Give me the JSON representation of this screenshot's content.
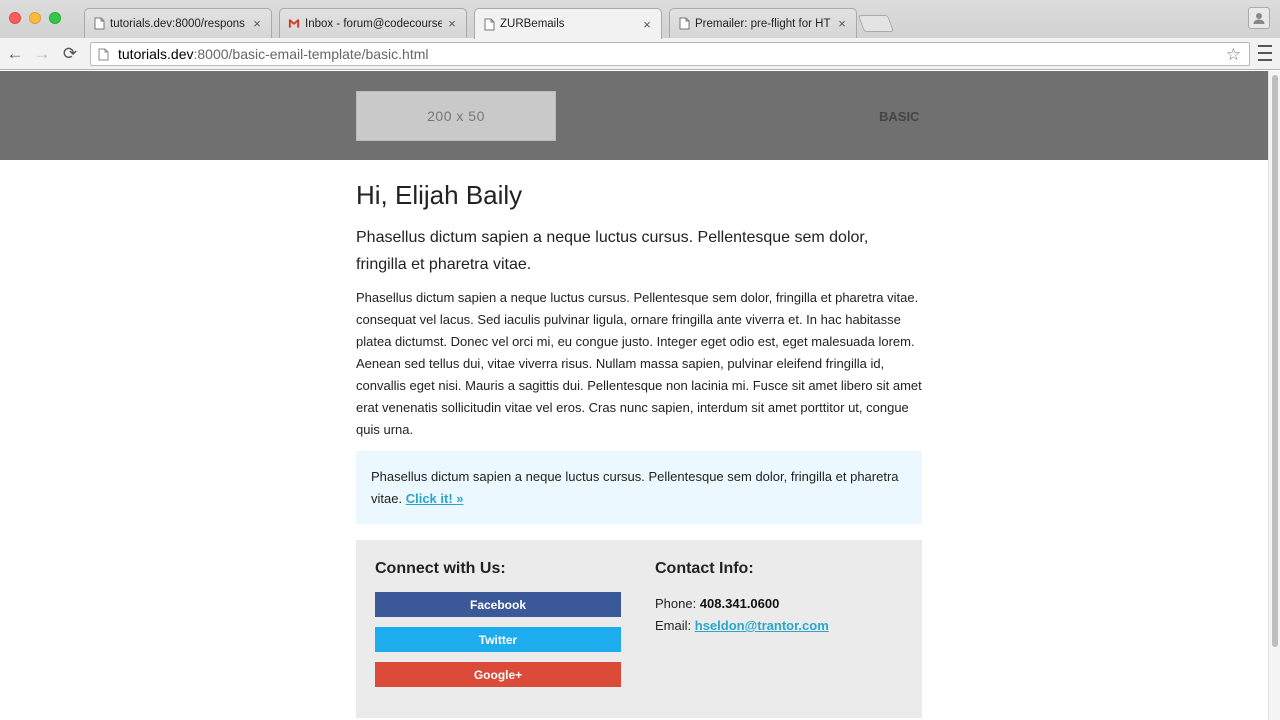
{
  "browser": {
    "tabs": [
      {
        "title": "tutorials.dev:8000/respons",
        "favicon": "page-icon",
        "active": false
      },
      {
        "title": "Inbox - forum@codecourse",
        "favicon": "gmail-icon",
        "active": false
      },
      {
        "title": "ZURBemails",
        "favicon": "page-icon",
        "active": true
      },
      {
        "title": "Premailer: pre-flight for HT",
        "favicon": "page-icon",
        "active": false
      }
    ],
    "tab_close_glyph": "×",
    "url_host": "tutorials.dev",
    "url_rest": ":8000/basic-email-template/basic.html",
    "back_glyph": "←",
    "forward_glyph": "→",
    "reload_glyph": "⟳",
    "star_glyph": "☆"
  },
  "email": {
    "header": {
      "logo_text": "200 x 50",
      "label": "BASIC"
    },
    "greeting": "Hi, Elijah Baily",
    "lead": "Phasellus dictum sapien a neque luctus cursus. Pellentesque sem dolor, fringilla et pharetra vitae.",
    "body": "Phasellus dictum sapien a neque luctus cursus. Pellentesque sem dolor, fringilla et pharetra vitae. consequat vel lacus. Sed iaculis pulvinar ligula, ornare fringilla ante viverra et. In hac habitasse platea dictumst. Donec vel orci mi, eu congue justo. Integer eget odio est, eget malesuada lorem. Aenean sed tellus dui, vitae viverra risus. Nullam massa sapien, pulvinar eleifend fringilla id, convallis eget nisi. Mauris a sagittis dui. Pellentesque non lacinia mi. Fusce sit amet libero sit amet erat venenatis sollicitudin vitae vel eros. Cras nunc sapien, interdum sit amet porttitor ut, congue quis urna.",
    "callout": {
      "text": "Phasellus dictum sapien a neque luctus cursus. Pellentesque sem dolor, fringilla et pharetra vitae.",
      "link": "Click it! »"
    },
    "social": {
      "heading": "Connect with Us:",
      "buttons": [
        {
          "label": "Facebook",
          "color": "#3b5998"
        },
        {
          "label": "Twitter",
          "color": "#1daced"
        },
        {
          "label": "Google+",
          "color": "#db4a39"
        }
      ]
    },
    "contact": {
      "heading": "Contact Info:",
      "phone_label": "Phone:",
      "phone": "408.341.0600",
      "email_label": "Email:",
      "email": "hseldon@trantor.com"
    }
  }
}
